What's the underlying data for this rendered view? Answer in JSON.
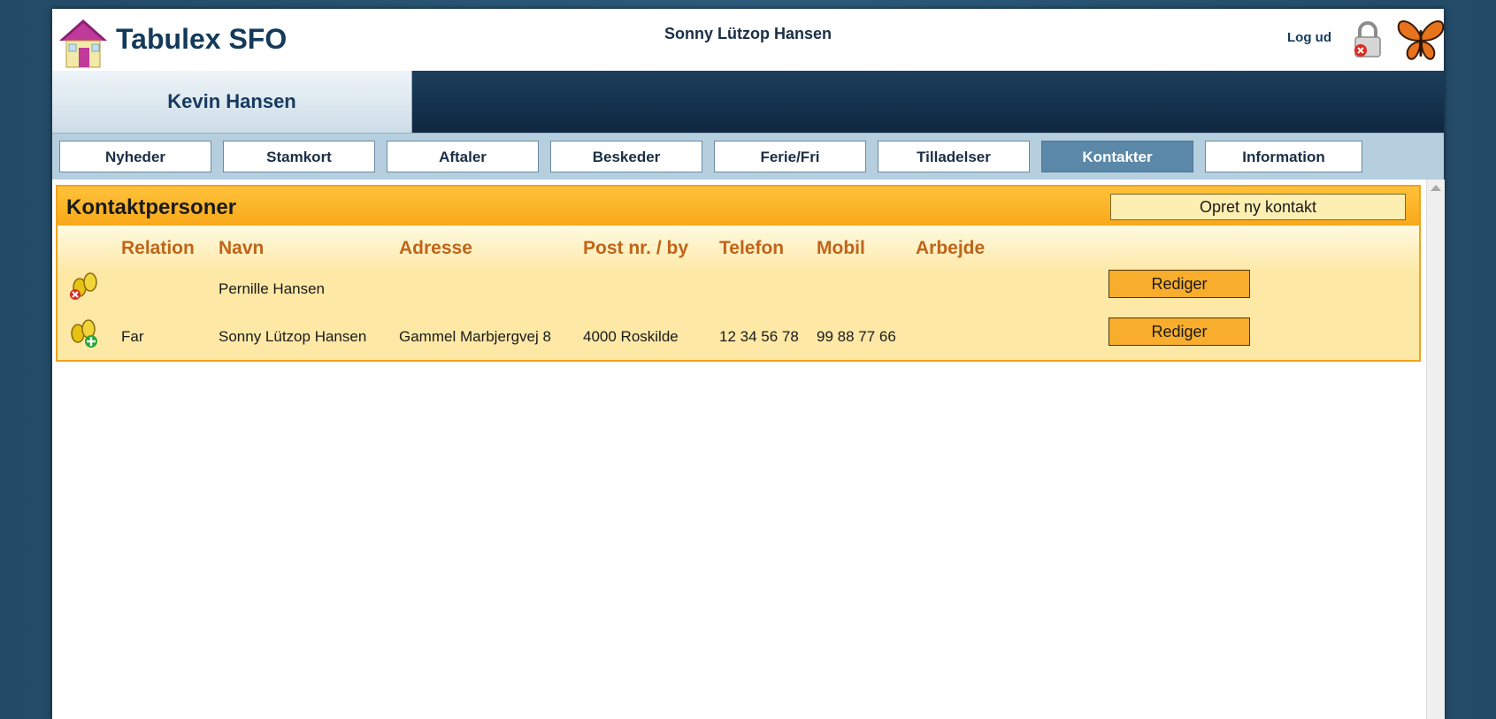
{
  "header": {
    "app_title": "Tabulex SFO",
    "user_name": "Sonny Lützop Hansen",
    "logout_label": "Log ud"
  },
  "child_tab": {
    "label": "Kevin Hansen"
  },
  "nav": {
    "items": [
      {
        "label": "Nyheder"
      },
      {
        "label": "Stamkort"
      },
      {
        "label": "Aftaler"
      },
      {
        "label": "Beskeder"
      },
      {
        "label": "Ferie/Fri"
      },
      {
        "label": "Tilladelser"
      },
      {
        "label": "Kontakter",
        "active": true
      },
      {
        "label": "Information"
      }
    ]
  },
  "panel": {
    "title": "Kontaktpersoner",
    "new_contact_label": "Opret ny kontakt",
    "columns": [
      "Relation",
      "Navn",
      "Adresse",
      "Post nr. / by",
      "Telefon",
      "Mobil",
      "Arbejde"
    ],
    "rows": [
      {
        "relation": "",
        "name": "Pernille Hansen",
        "address": "",
        "postal": "",
        "phone": "",
        "mobile": "",
        "work": "",
        "icon": "users-remove-icon",
        "edit_label": "Rediger"
      },
      {
        "relation": "Far",
        "name": "Sonny Lützop Hansen",
        "address": "Gammel Marbjergvej 8",
        "postal": "4000 Roskilde",
        "phone": "12 34 56 78",
        "mobile": "99 88 77 66",
        "work": "",
        "icon": "users-add-icon",
        "edit_label": "Rediger"
      }
    ]
  },
  "colors": {
    "navy": "#143a5a",
    "panel_border": "#f2a21d",
    "panel_bg": "#fde8a6",
    "header_orange": "#f9a81a",
    "column_text": "#c0641a",
    "active_tab": "#5b88a8"
  }
}
